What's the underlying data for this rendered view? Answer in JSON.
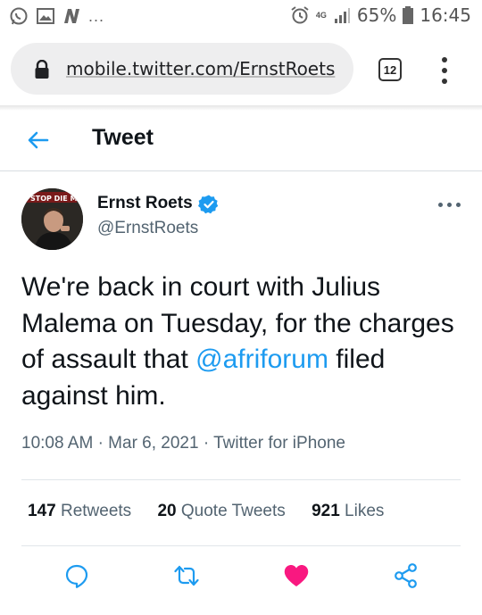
{
  "status_bar": {
    "network": "4G",
    "battery": "65%",
    "time": "16:45",
    "overflow": "..."
  },
  "browser": {
    "url": "mobile.twitter.com/ErnstRoets",
    "tab_count": "12"
  },
  "header": {
    "title": "Tweet"
  },
  "tweet": {
    "author_name": "Ernst Roets",
    "author_handle": "@ErnstRoets",
    "avatar_badge_text": "STOP DIE MOORDE",
    "text_before": "We're back in court with Julius Malema on Tuesday, for the charges of assault that ",
    "mention": "@afriforum",
    "text_after": " filed against him.",
    "time": "10:08 AM",
    "date": "Mar 6, 2021",
    "source": "Twitter for iPhone",
    "separator": "·"
  },
  "stats": {
    "retweets_count": "147",
    "retweets_label": "Retweets",
    "quotes_count": "20",
    "quotes_label": "Quote Tweets",
    "likes_count": "921",
    "likes_label": "Likes"
  },
  "colors": {
    "accent": "#1d9bf0",
    "like": "#f91880",
    "text": "#0f1419",
    "secondary": "#536471"
  }
}
